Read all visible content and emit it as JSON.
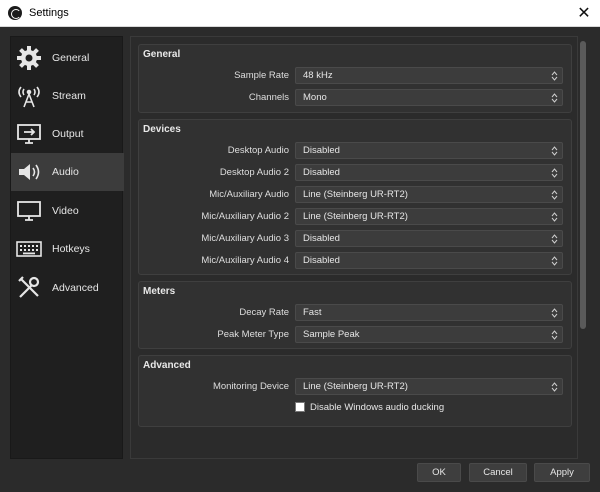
{
  "window": {
    "title": "Settings"
  },
  "sidebar": {
    "items": [
      {
        "label": "General",
        "icon": "gear-icon"
      },
      {
        "label": "Stream",
        "icon": "antenna-icon"
      },
      {
        "label": "Output",
        "icon": "monitor-arrow-icon"
      },
      {
        "label": "Audio",
        "icon": "speaker-icon",
        "active": true
      },
      {
        "label": "Video",
        "icon": "monitor-icon"
      },
      {
        "label": "Hotkeys",
        "icon": "keyboard-icon"
      },
      {
        "label": "Advanced",
        "icon": "tools-icon"
      }
    ]
  },
  "general": {
    "title": "General",
    "sample_rate_label": "Sample Rate",
    "sample_rate_value": "48 kHz",
    "channels_label": "Channels",
    "channels_value": "Mono"
  },
  "devices": {
    "title": "Devices",
    "rows": [
      {
        "label": "Desktop Audio",
        "value": "Disabled"
      },
      {
        "label": "Desktop Audio 2",
        "value": "Disabled"
      },
      {
        "label": "Mic/Auxiliary Audio",
        "value": "Line (Steinberg UR-RT2)"
      },
      {
        "label": "Mic/Auxiliary Audio 2",
        "value": "Line (Steinberg UR-RT2)"
      },
      {
        "label": "Mic/Auxiliary Audio 3",
        "value": "Disabled"
      },
      {
        "label": "Mic/Auxiliary Audio 4",
        "value": "Disabled"
      }
    ]
  },
  "meters": {
    "title": "Meters",
    "decay_label": "Decay Rate",
    "decay_value": "Fast",
    "peak_label": "Peak Meter Type",
    "peak_value": "Sample Peak"
  },
  "advanced": {
    "title": "Advanced",
    "monitoring_label": "Monitoring Device",
    "monitoring_value": "Line (Steinberg UR-RT2)",
    "ducking_label": "Disable Windows audio ducking",
    "ducking_checked": false
  },
  "buttons": {
    "ok": "OK",
    "cancel": "Cancel",
    "apply": "Apply"
  },
  "colors": {
    "background": "#2b2b2b",
    "sidebar": "#1f1f1f",
    "active_item": "#3c3c3c",
    "panel": "#313131"
  }
}
